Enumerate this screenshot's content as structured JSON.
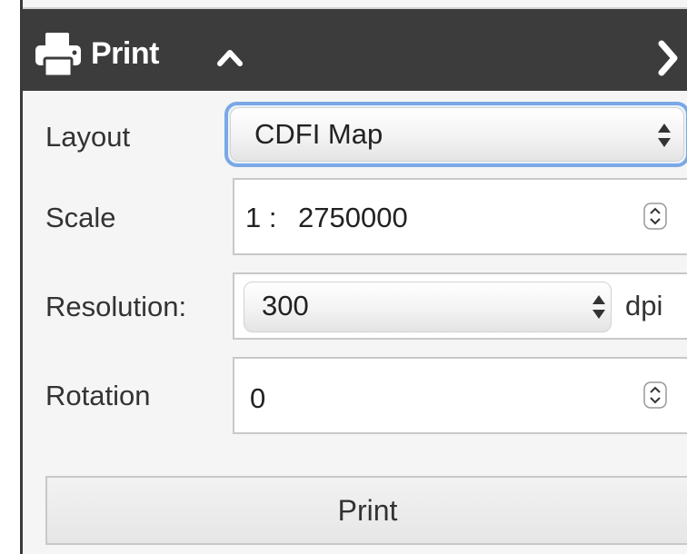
{
  "header": {
    "title": "Print",
    "icons": [
      "printer-icon",
      "chevron-up-icon",
      "chevron-right-icon"
    ]
  },
  "form": {
    "layout": {
      "label": "Layout",
      "value": "CDFI Map"
    },
    "scale": {
      "label": "Scale",
      "prefix": "1 :",
      "value": "2750000"
    },
    "resolution": {
      "label": "Resolution:",
      "value": "300",
      "unit": "dpi"
    },
    "rotation": {
      "label": "Rotation",
      "value": "0"
    }
  },
  "actions": {
    "print_label": "Print"
  },
  "colors": {
    "header_bg": "#3c3c3c",
    "panel_bg": "#f5f5f5",
    "focus_ring": "#7aa8e6"
  }
}
